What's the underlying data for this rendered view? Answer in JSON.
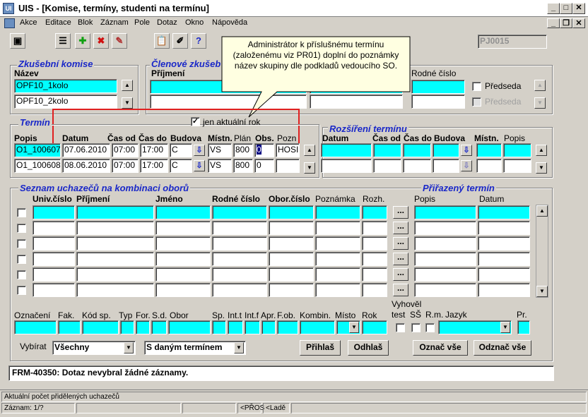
{
  "window": {
    "title": "UIS - [Komise, termíny, studenti na termínu]",
    "icon": "UI"
  },
  "menu": [
    "Akce",
    "Editace",
    "Blok",
    "Záznam",
    "Pole",
    "Dotaz",
    "Okno",
    "Nápověda"
  ],
  "toolbar": {
    "code": "PJ0015"
  },
  "tooltip": "Administrátor k příslušnému termínu (založenému viz PR01) doplní do poznámky název skupiny dle podkladů vedoucího SO.",
  "komise": {
    "title": "Zkušební komise",
    "label": "Název",
    "rows": [
      "OPF10_1kolo",
      "OPF10_2kolo"
    ]
  },
  "clenove": {
    "title": "Členové zkušeb",
    "prijmeni_label": "Příjmení",
    "rodne_label": "Rodné číslo",
    "predseda_label": "Předseda"
  },
  "termin": {
    "title": "Termín",
    "aktualni_label": "jen aktuální rok",
    "aktualni_checked": true,
    "headers": [
      "Popis",
      "Datum",
      "Čas od",
      "Čas do",
      "Budova",
      "Místn.",
      "Plán",
      "Obs.",
      "Pozn"
    ],
    "rows": [
      [
        "O1_100607",
        "07.06.2010",
        "07:00",
        "17:00",
        "C",
        "VS",
        "800",
        "0",
        "HOSI"
      ],
      [
        "O1_100608",
        "08.06.2010",
        "07:00",
        "17:00",
        "C",
        "VS",
        "800",
        "0",
        ""
      ]
    ]
  },
  "rozsireni": {
    "title": "Rozšíření termínu",
    "headers": [
      "Datum",
      "Čas od",
      "Čas do",
      "Budova",
      "Místn.",
      "Popis"
    ]
  },
  "uchazeci": {
    "title": "Seznam uchazečů na kombinaci oborů",
    "headers": [
      "Univ.číslo",
      "Příjmení",
      "Jméno",
      "Rodné číslo",
      "Obor.číslo",
      "Poznámka",
      "Rozh."
    ],
    "prirazeny_title": "Přiřazený termín",
    "prirazeny_headers": [
      "Popis",
      "Datum"
    ],
    "dots": "..."
  },
  "detail": {
    "labels": [
      "Označení",
      "Fak.",
      "Kód sp.",
      "Typ",
      "For.",
      "S.d.",
      "Obor",
      "Sp.",
      "Int.t",
      "Int.f",
      "Apr.",
      "F.ob.",
      "Kombin.",
      "Místo",
      "Rok"
    ],
    "vyhovel_label": "Vyhověl",
    "test_labels": [
      "test",
      "SŠ",
      "R.m.",
      "Jazyk"
    ],
    "pr_label": "Pr."
  },
  "filter": {
    "label": "Vybírat",
    "value1": "Všechny",
    "value2": "S daným termínem"
  },
  "buttons": {
    "prihlas": "Přihlaš",
    "odhlas": "Odhlaš",
    "oznac": "Označ vše",
    "odznac": "Odznač vše"
  },
  "message": "FRM-40350: Dotaz nevybral žádné záznamy.",
  "statusbar": {
    "hint": "Aktuální počet přidělených uchazečů",
    "zaznam": "Záznam: 1/?",
    "pros": "<PŘOS",
    "lade": "<Ladě"
  }
}
